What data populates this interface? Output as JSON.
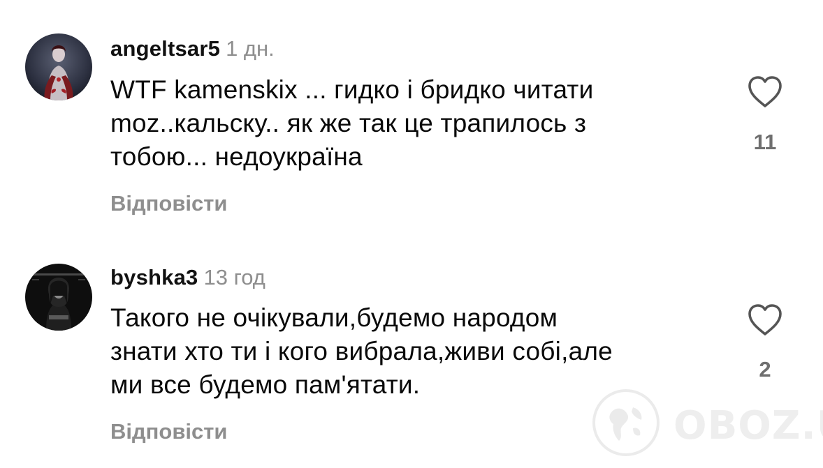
{
  "comments": [
    {
      "username": "angeltsar5",
      "time": "1 дн.",
      "text_lines": [
        "WTF kamenskix ... гидко і бридко читати",
        "moz..кальску.. як же так  це трапилось з",
        "тобою... недоукраїна"
      ],
      "reply_label": "Відповісти",
      "like_icon": "heart-outline-icon",
      "likes": "11"
    },
    {
      "username": "byshka3",
      "time": "13 год",
      "text_lines": [
        "Такого не очікували,будемо народом",
        "знати хто ти і кого вибрала,живи собі,але",
        "ми все будемо пам'ятати."
      ],
      "reply_label": "Відповісти",
      "like_icon": "heart-outline-icon",
      "likes": "2"
    }
  ],
  "watermark": {
    "text": "OBOZ.UA"
  },
  "colors": {
    "secondary_text": "#8e8e8e",
    "primary_text": "#0a0a0a",
    "background": "#ffffff"
  }
}
